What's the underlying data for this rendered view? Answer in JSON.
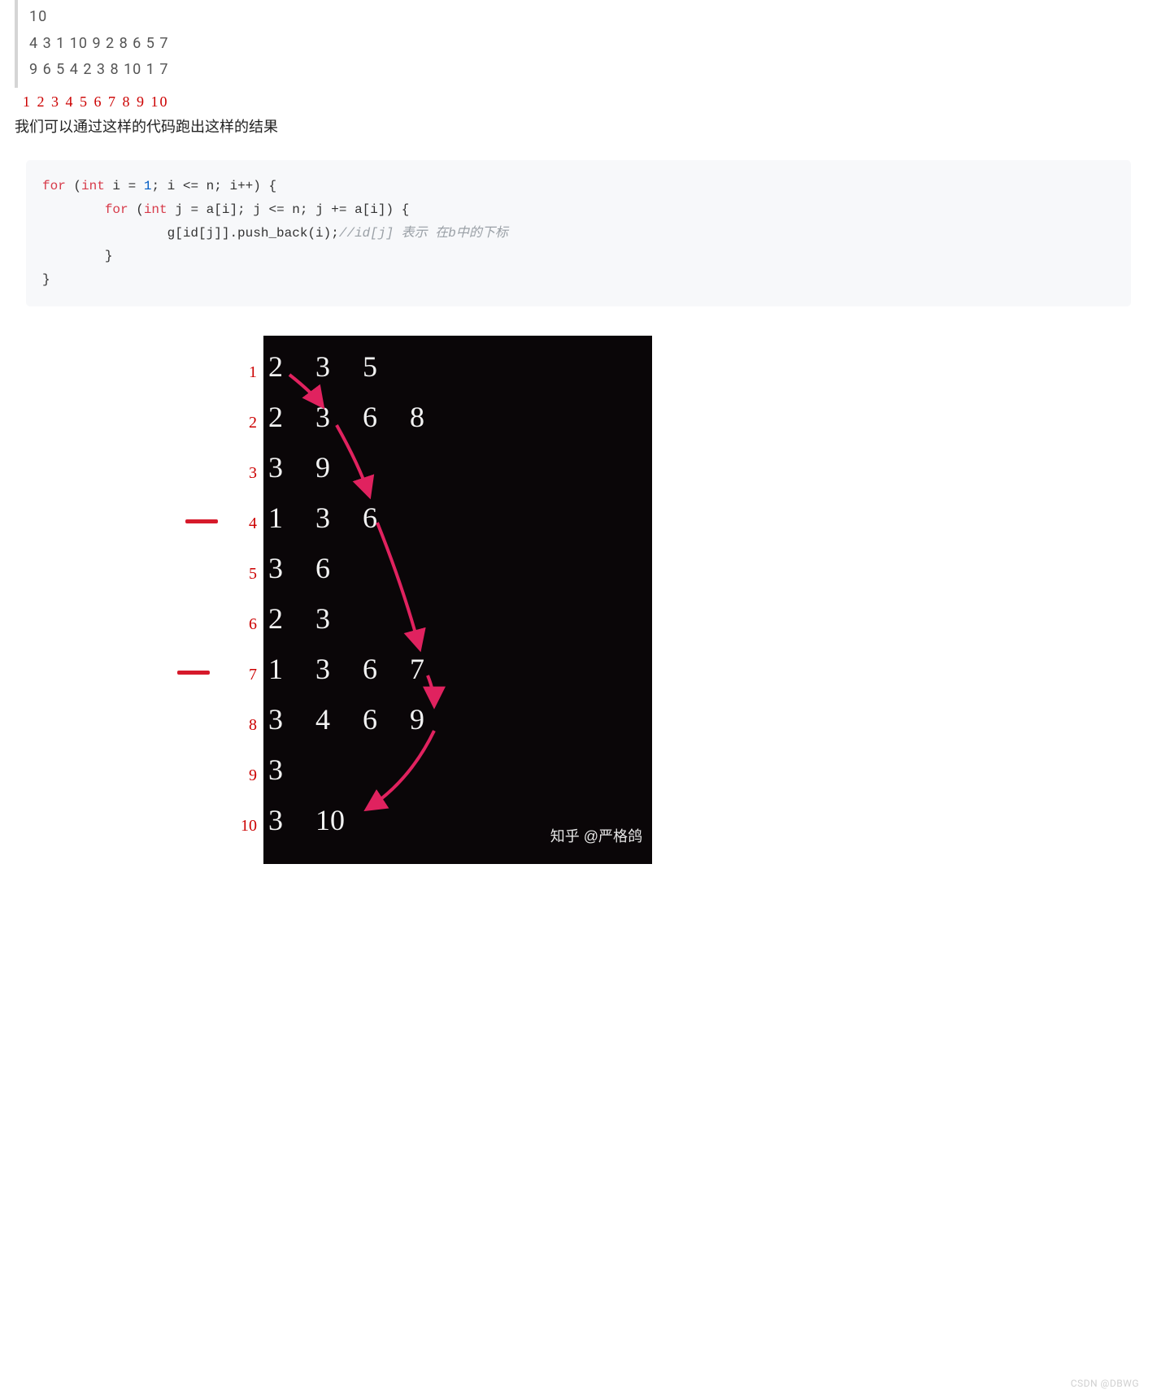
{
  "quote": {
    "line1": "10",
    "line2": "4 3 1 10 9 2 8 6 5 7",
    "line3": "9 6 5 4 2 3 8 10 1 7"
  },
  "red_sequence": "1 2 3 4 5 6 7 8 9 10",
  "body_text": "我们可以通过这样的代码跑出这样的结果",
  "code": {
    "l1a": "for",
    "l1b": "int",
    "l1c": "1",
    "l1_rest1": " (",
    "l1_rest2": " i = ",
    "l1_rest3": "; i <= n; i++) {",
    "l2a": "for",
    "l2b": "int",
    "l2_rest1": "        ",
    "l2_rest2": " (",
    "l2_rest3": " j = a[i]; j <= n; j += a[i]) {",
    "l3": "                g[id[j]].push_back(i);",
    "l3_cmt": "//id[j] 表示 在b中的下标",
    "l4": "        }",
    "l5": "}"
  },
  "diagram": {
    "row_labels": [
      "1",
      "2",
      "3",
      "4",
      "5",
      "6",
      "7",
      "8",
      "9",
      "10"
    ],
    "rows": [
      [
        "2",
        "3",
        "5"
      ],
      [
        "2",
        "3",
        "6",
        "8"
      ],
      [
        "3",
        "9"
      ],
      [
        "1",
        "3",
        "6"
      ],
      [
        "3",
        "6"
      ],
      [
        "2",
        "3"
      ],
      [
        "1",
        "3",
        "6",
        "7"
      ],
      [
        "3",
        "4",
        "6",
        "9"
      ],
      [
        "3"
      ],
      [
        "3",
        "10"
      ]
    ],
    "watermark": "知乎 @严格鸽"
  },
  "csdn": "CSDN @DBWG"
}
